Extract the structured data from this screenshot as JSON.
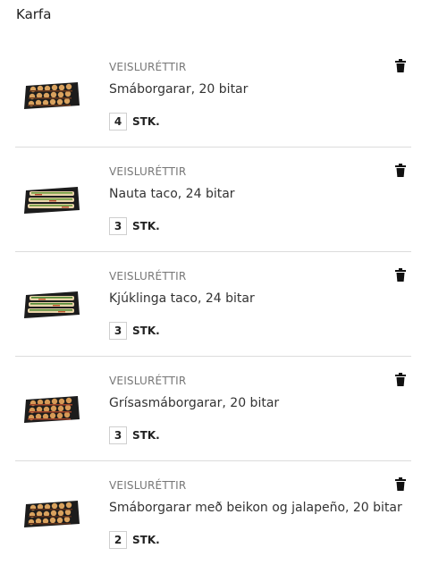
{
  "page": {
    "title": "Karfa"
  },
  "cart": {
    "items": [
      {
        "category": "VEISLURÉTTIR",
        "name": "Smáborgarar, 20 bitar",
        "qty": "4",
        "unit": "STK.",
        "image": "sliders"
      },
      {
        "category": "VEISLURÉTTIR",
        "name": "Nauta taco, 24 bitar",
        "qty": "3",
        "unit": "STK.",
        "image": "taco"
      },
      {
        "category": "VEISLURÉTTIR",
        "name": "Kjúklinga taco, 24 bitar",
        "qty": "3",
        "unit": "STK.",
        "image": "taco"
      },
      {
        "category": "VEISLURÉTTIR",
        "name": "Grísasmáborgarar, 20 bitar",
        "qty": "3",
        "unit": "STK.",
        "image": "sliders"
      },
      {
        "category": "VEISLURÉTTIR",
        "name": "Smáborgarar með beikon og jalapeño, 20 bitar",
        "qty": "2",
        "unit": "STK.",
        "image": "sliders"
      }
    ]
  },
  "icons": {
    "delete": "trash-icon"
  },
  "colors": {
    "text": "#222222",
    "muted": "#777777",
    "divider": "#dcdcdc"
  }
}
